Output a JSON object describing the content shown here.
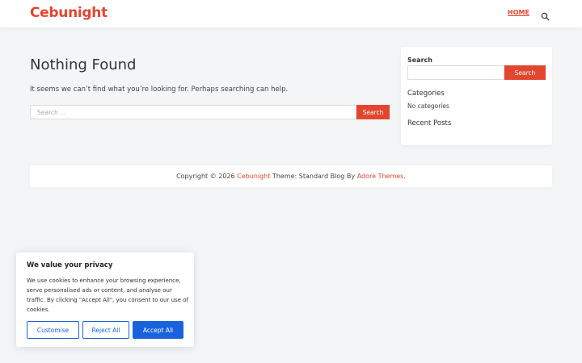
{
  "header": {
    "logo": "Cebunight",
    "nav": {
      "home_label": "HOME"
    },
    "search_icon": "search-icon"
  },
  "main": {
    "title": "Nothing Found",
    "message": "It seems we can’t find what you’re looking for. Perhaps searching can help.",
    "search_placeholder": "Search …",
    "search_button": "Search"
  },
  "sidebar": {
    "search_label": "Search",
    "search_button": "Search",
    "categories_title": "Categories",
    "categories_empty": "No categories",
    "recent_posts_title": "Recent Posts"
  },
  "footer": {
    "prefix": "Copyright © 2026 ",
    "site_link": "Cebunight",
    "middle": " Theme: Standard Blog By ",
    "theme_link": "Adore Themes",
    "suffix": "."
  },
  "cookie": {
    "title": "We value your privacy",
    "text": "We use cookies to enhance your browsing experience, serve personalised ads or content, and analyse our traffic. By clicking \"Accept All\", you consent to our use of cookies.",
    "customise_label": "Customise",
    "reject_label": "Reject All",
    "accept_label": "Accept All"
  },
  "colors": {
    "accent": "#e2462f",
    "cookie_blue": "#1863dc",
    "background": "#f4f5f7"
  }
}
